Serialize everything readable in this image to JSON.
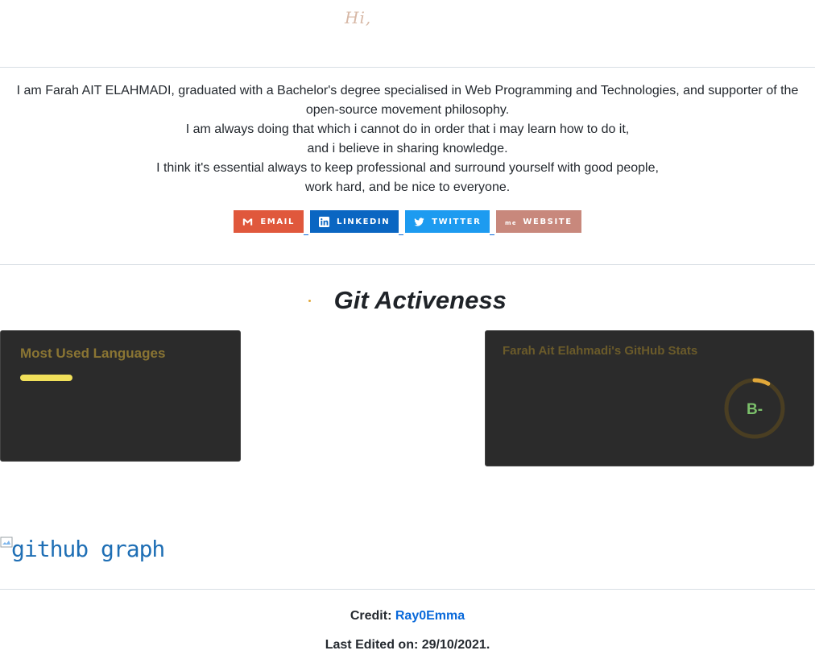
{
  "greeting": "Hi,",
  "bio": {
    "lines": [
      "I am Farah AIT ELAHMADI, graduated with a Bachelor's degree specialised in Web Programming and Technologies, and supporter of the",
      "open-source movement philosophy.",
      "I am always doing that which i cannot do in order that i may learn how to do it,",
      "and i believe in sharing knowledge.",
      "I think it's essential always to keep professional and surround yourself with good people,",
      "work hard, and be nice to everyone."
    ]
  },
  "badges": [
    {
      "label": "EMAIL",
      "icon": "gmail-icon",
      "color": "#e0583c"
    },
    {
      "label": "LINKEDIN",
      "icon": "linkedin-icon",
      "color": "#0a66c2"
    },
    {
      "label": "TWITTER",
      "icon": "twitter-icon",
      "color": "#1d9bf0"
    },
    {
      "label": "WEBSITE",
      "icon": "about-me-icon",
      "color": "#c8887c"
    }
  ],
  "section": {
    "title": "Git Activeness"
  },
  "languages_card": {
    "title": "Most Used Languages"
  },
  "stats_card": {
    "title": "Farah Ait Elahmadi's GitHub Stats",
    "grade": "B-",
    "grade_progress": 0.08
  },
  "graph_alt": "github graph",
  "footer": {
    "credit_label": "Credit:",
    "credit_link": "Ray0Emma",
    "edited": "Last Edited on: 29/10/2021."
  }
}
